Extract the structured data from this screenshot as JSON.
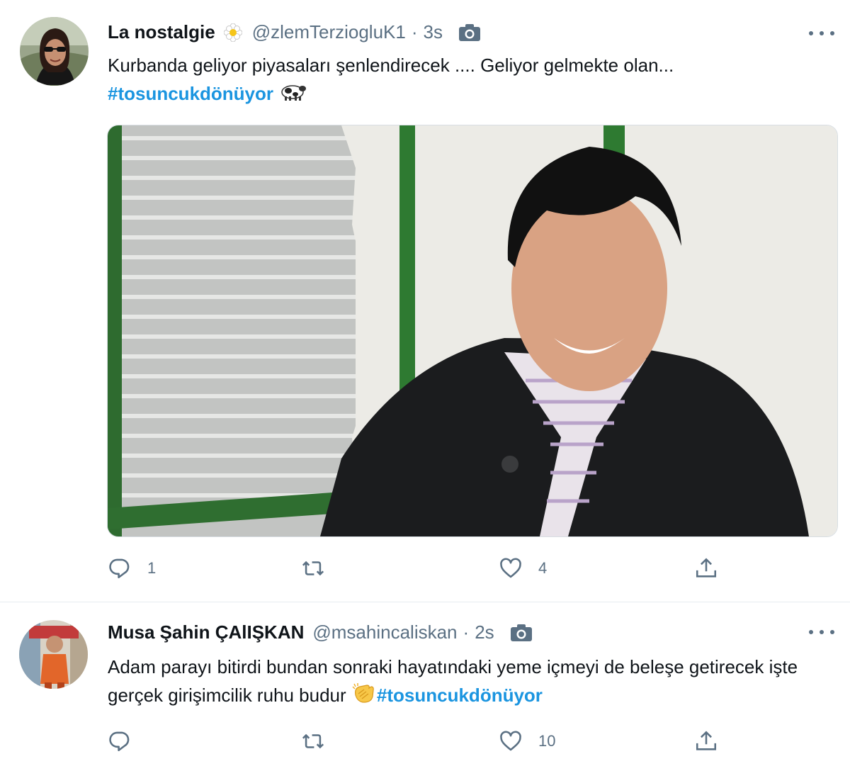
{
  "tweets": [
    {
      "display_name": "La nostalgie",
      "handle": "@zlemTerziogluK1",
      "separator": "·",
      "time": "3s",
      "text": "Kurbanda geliyor  piyasaları şenlendirecek .... Geliyor gelmekte olan...",
      "hashtag": "#tosuncukdönüyor",
      "reply_count": "1",
      "retweet_count": "",
      "like_count": "4"
    },
    {
      "display_name": "Musa Şahin ÇAlIŞKAN",
      "handle": "@msahincaliskan",
      "separator": "·",
      "time": "2s",
      "text": "Adam parayı bitirdi bundan sonraki hayatındaki yeme içmeyi de beleşe getirecek işte gerçek girişimcilik ruhu budur ",
      "hashtag": "#tosuncukdönüyor",
      "reply_count": "",
      "retweet_count": "",
      "like_count": "10"
    }
  ],
  "icons": {
    "flower": "blossom-emoji-icon",
    "camera": "camera-icon",
    "more": "more-options-icon",
    "reply": "reply-icon",
    "retweet": "retweet-icon",
    "like": "heart-icon",
    "share": "share-icon",
    "cow": "cow-emoji-icon",
    "clap": "clapping-hands-emoji-icon"
  },
  "colors": {
    "hashtag": "#1b95e0",
    "secondary_text": "#5b7083",
    "primary_text": "#0f1419",
    "divider": "#e6ecf0"
  }
}
